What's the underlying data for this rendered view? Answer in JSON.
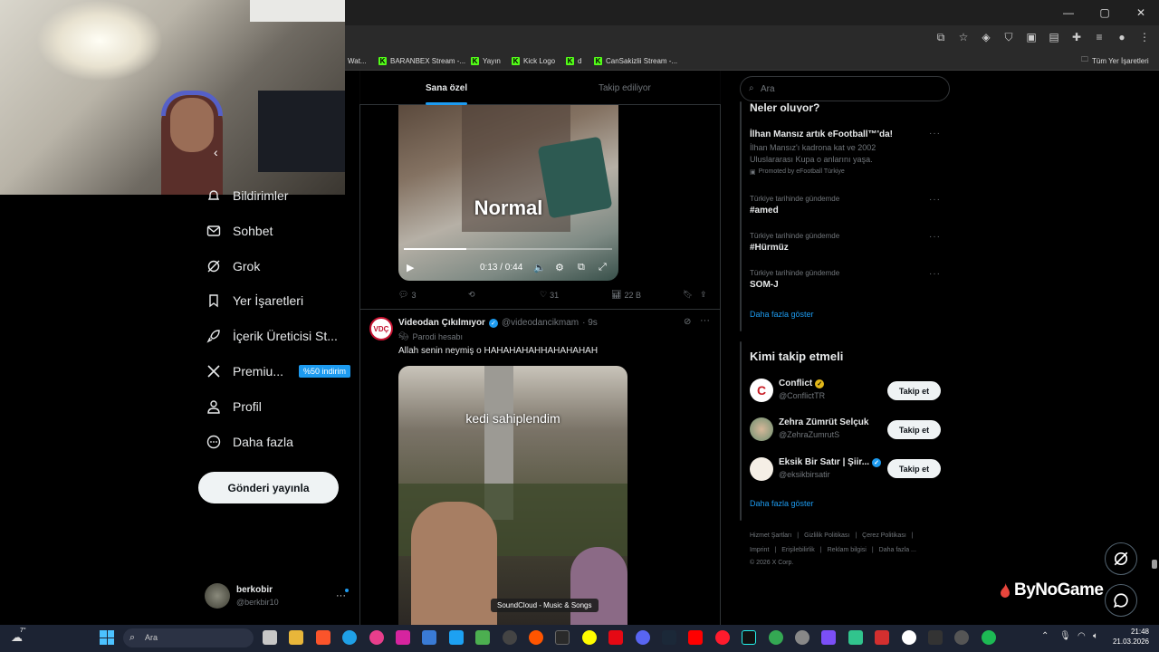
{
  "window": {
    "minimize": "—",
    "maximize": "▢",
    "close": "✕"
  },
  "bookmarks": [
    {
      "label": "Wat...",
      "kick": false
    },
    {
      "label": "BARANBEX Stream -...",
      "kick": true
    },
    {
      "label": "Yayın",
      "kick": true
    },
    {
      "label": "Kick Logo",
      "kick": true
    },
    {
      "label": "d",
      "kick": true
    },
    {
      "label": "CanSakizlii Stream -...",
      "kick": true
    }
  ],
  "bookmarks_folder": "Tüm Yer İşaretleri",
  "nav": {
    "notifications": "Bildirimler",
    "chat": "Sohbet",
    "grok": "Grok",
    "bookmarks": "Yer İşaretleri",
    "creator": "İçerik Üreticisi St...",
    "premium": "Premiu...",
    "premium_badge": "%50 indirim",
    "profile": "Profil",
    "more": "Daha fazla",
    "post_button": "Gönderi yayınla"
  },
  "account": {
    "name": "berkobir",
    "handle": "@berkbir10",
    "more": "···"
  },
  "feed": {
    "tabs": [
      "Sana özel",
      "Takip ediliyor"
    ],
    "video": {
      "overlay_text": "Normal",
      "time": "0:13 / 0:44",
      "progress": 0.3
    },
    "actions1": {
      "replies": "3",
      "reposts": "",
      "likes": "31",
      "views": "22 B"
    },
    "tweet2": {
      "name": "Videodan Çıkılmıyor",
      "handle": "@videodancikmam",
      "time": "· 9s",
      "badge": "Parodi hesabı",
      "text": "Allah senin neymiş o HAHAHAHAHHAHAHAHAH",
      "avatar_text": "VDÇ",
      "image_caption": "kedi sahiplendim",
      "tooltip": "SoundCloud - Music & Songs"
    }
  },
  "right": {
    "search_placeholder": "Ara",
    "trends_title": "Neler oluyor?",
    "promo": {
      "title": "İlhan Mansız artık eFootball™'da!",
      "body1": "İlhan Mansız'ı kadrona kat ve 2002",
      "body2": "Uluslararası Kupa o anlarını yaşa.",
      "promoted": "Promoted by eFootball Türkiye"
    },
    "trends": [
      {
        "meta": "Türkiye tarihinde gündemde",
        "name": "#amed"
      },
      {
        "meta": "Türkiye tarihinde gündemde",
        "name": "#Hürmüz"
      },
      {
        "meta": "Türkiye tarihinde gündemde",
        "name": "SOM-J"
      }
    ],
    "show_more": "Daha fazla göster",
    "who_title": "Kimi takip etmeli",
    "who": [
      {
        "name": "Conflict",
        "handle": "@ConflictTR",
        "button": "Takip et"
      },
      {
        "name": "Zehra Zümrüt Selçuk",
        "handle": "@ZehraZumrutS",
        "button": "Takip et"
      },
      {
        "name": "Eksik Bir Satır | Şiir...",
        "handle": "@eksikbirsatir",
        "button": "Takip et"
      }
    ],
    "show_more2": "Daha fazla göster",
    "footer1": [
      "Hizmet Şartları",
      "|",
      "Gizlilik Politikası",
      "|",
      "Çerez Politikası",
      "|"
    ],
    "footer2": [
      "Imprint",
      "|",
      "Erişilebilirlik",
      "|",
      "Reklam bilgisi",
      "|",
      "Daha fazla ..."
    ],
    "copyright": "© 2026 X Corp."
  },
  "watermark": "ByNoGame",
  "taskbar": {
    "weather": "7°",
    "search": "Ara",
    "time": "21:48",
    "date": "21.03.2026"
  },
  "colors": {
    "accent": "#1d9bf0",
    "bg": "#000000",
    "taskbar": "#1c2333"
  }
}
